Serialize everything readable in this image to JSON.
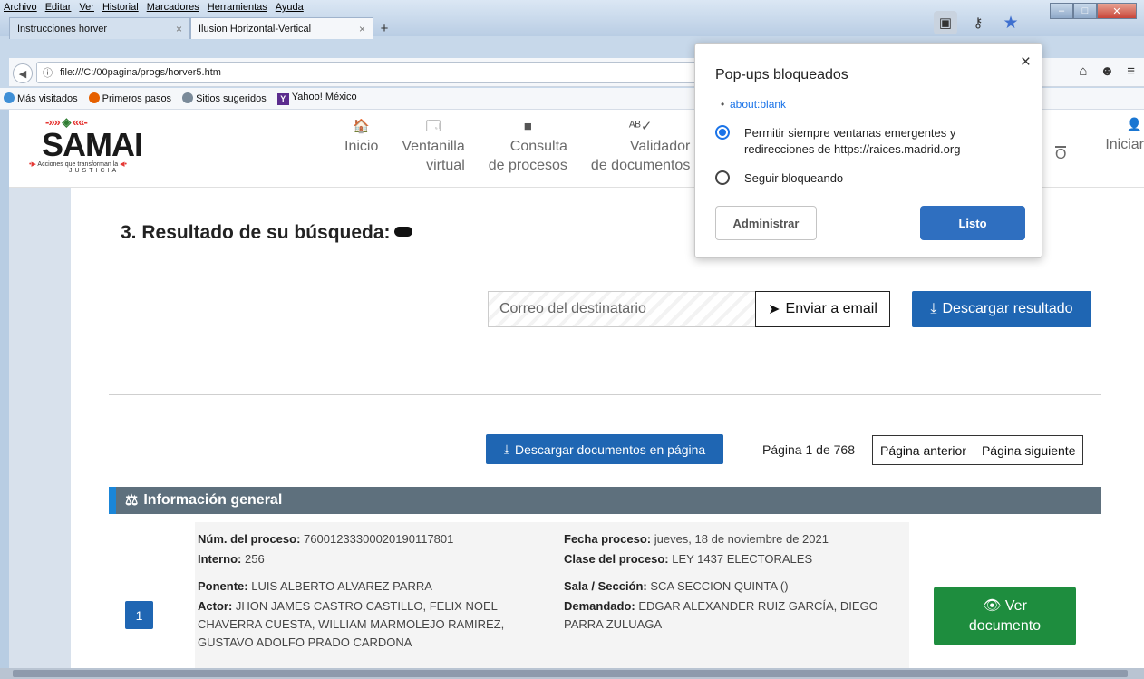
{
  "browser": {
    "menu": [
      "Archivo",
      "Editar",
      "Ver",
      "Historial",
      "Marcadores",
      "Herramientas",
      "Ayuda"
    ],
    "tabs": [
      {
        "label": "Instrucciones horver",
        "close": "×"
      },
      {
        "label": "Ilusion Horizontal-Vertical",
        "close": "×"
      }
    ],
    "new_tab": "+",
    "url": "file:///C:/00pagina/progs/horver5.htm",
    "bookmarks": [
      "Más visitados",
      "Primeros pasos",
      "Sitios sugeridos",
      "Yahoo! México"
    ]
  },
  "site": {
    "logo": {
      "name": "SAMAI",
      "tagline": "Acciones que transforman la",
      "word": "JUSTICIA"
    },
    "nav": [
      {
        "icon": "home-icon",
        "glyph": "🏠",
        "lines": [
          "Inicio"
        ]
      },
      {
        "icon": "window-icon",
        "glyph": "🗔",
        "lines": [
          "Ventanilla",
          "virtual"
        ]
      },
      {
        "icon": "folder-icon",
        "glyph": "■",
        "lines": [
          "Consulta",
          "de procesos"
        ]
      },
      {
        "icon": "ab-check-icon",
        "glyph": "ᴬᴮ✓",
        "lines": [
          "Validador",
          "de documentos"
        ]
      }
    ],
    "login": "Iniciar",
    "partial_o": "O"
  },
  "content": {
    "result_title": "3. Resultado de su búsqueda:",
    "email_placeholder": "Correo del destinatario",
    "email_button": "Enviar a email",
    "download_result": "Descargar resultado",
    "download_docs": "Descargar documentos en página",
    "page_info": "Página 1 de 768",
    "prev_page": "Página anterior",
    "next_page": "Página siguiente",
    "info_header": "Información general",
    "record": {
      "index": "1",
      "num_label": "Núm. del proceso:",
      "num_value": "76001233300020190117801",
      "interno_label": "Interno:",
      "interno_value": "256",
      "fecha_label": "Fecha proceso:",
      "fecha_value": "jueves, 18 de noviembre de 2021",
      "clase_label": "Clase del proceso:",
      "clase_value": "LEY 1437 ELECTORALES",
      "ponente_label": "Ponente:",
      "ponente_value": "LUIS ALBERTO ALVAREZ PARRA",
      "sala_label": "Sala / Sección:",
      "sala_value": "SCA SECCION QUINTA ()",
      "actor_label": "Actor:",
      "actor_value": "JHON JAMES CASTRO CASTILLO, FELIX NOEL CHAVERRA CUESTA, WILLIAM MARMOLEJO RAMIREZ, GUSTAVO ADOLFO PRADO CARDONA",
      "demandado_label": "Demandado:",
      "demandado_value": "EDGAR ALEXANDER RUIZ GARCÍA, DIEGO PARRA ZULUAGA",
      "ver_line1": "Ver",
      "ver_line2": "documento"
    }
  },
  "popup": {
    "title": "Pop-ups bloqueados",
    "link": "about:blank",
    "option_allow": "Permitir siempre ventanas emergentes y redirecciones de https://raices.madrid.org",
    "option_block": "Seguir bloqueando",
    "manage": "Administrar",
    "done": "Listo",
    "close": "×"
  },
  "colors": {
    "primary": "#1f66b3",
    "success": "#1e8d3e",
    "info_bar": "#5e707d",
    "accent": "#1b86d8"
  }
}
